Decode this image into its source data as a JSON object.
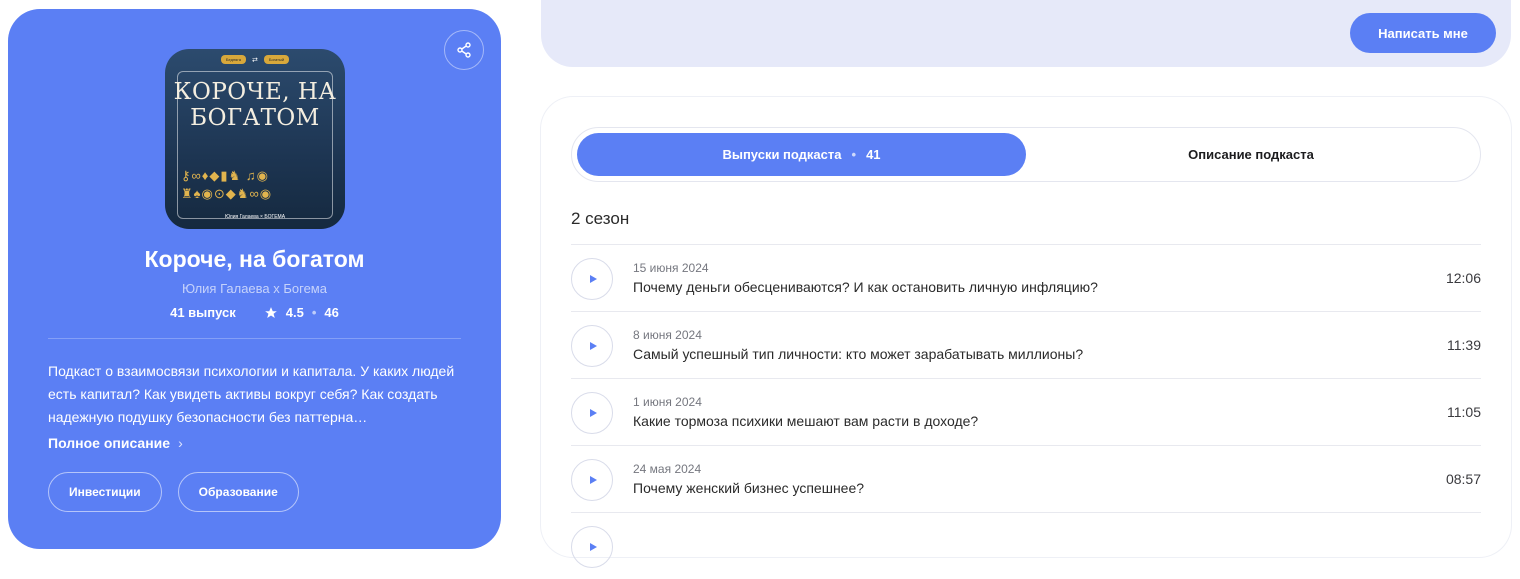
{
  "podcast": {
    "title": "Короче, на богатом",
    "author": "Юлия Галаева х Богема",
    "episodes_count": "41 выпуск",
    "rating": "4.5",
    "ratings_count": "46",
    "description": "Подкаст о взаимосвязи психологии и капитала. У каких людей есть капитал? Как увидеть активы вокруг себя? Как создать надежную подушку безопасности без паттерна…",
    "full_description_link": "Полное описание",
    "tags": [
      "Инвестиции",
      "Образование"
    ],
    "cover": {
      "title_line1": "КОРОЧЕ, НА",
      "title_line2": "БОГАТОМ",
      "pill_left": "Бедняга",
      "pill_right": "Богатый",
      "footer": "Юлия Галаева × БОГЕМА"
    }
  },
  "header": {
    "write_button": "Написать мне"
  },
  "tabs": {
    "episodes_label": "Выпуски подкаста",
    "episodes_count": "41",
    "description_label": "Описание подкаста"
  },
  "season": "2 сезон",
  "episodes": [
    {
      "date": "15 июня 2024",
      "title": "Почему деньги обесцениваются? И как остановить личную инфляцию?",
      "duration": "12:06"
    },
    {
      "date": "8 июня 2024",
      "title": "Самый успешный тип личности: кто может зарабатывать миллионы?",
      "duration": "11:39"
    },
    {
      "date": "1 июня 2024",
      "title": "Какие тормоза психики мешают вам расти в доходе?",
      "duration": "11:05"
    },
    {
      "date": "24 мая 2024",
      "title": "Почему женский бизнес успешнее?",
      "duration": "08:57"
    }
  ],
  "colors": {
    "accent": "#5b7ff4",
    "top_bar": "#e6e9f9"
  }
}
